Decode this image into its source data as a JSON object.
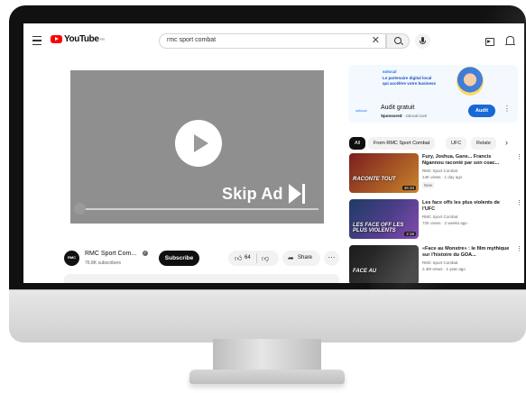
{
  "header": {
    "logo_text": "YouTube",
    "logo_region": "FR",
    "search_value": "rmc sport combat"
  },
  "player": {
    "skip_label": "Skip Ad"
  },
  "channel": {
    "avatar_text": "RMC",
    "name": "RMC Sport Com...",
    "subscribers": "76.8K subscribers",
    "subscribe_label": "Subscribe",
    "likes": "64",
    "share_label": "Share"
  },
  "ad": {
    "brand": "solocal",
    "headline_1": "Le partenaire digital local",
    "headline_2": "qui accélère votre business",
    "small_logo": "solocal",
    "title": "Audit gratuit",
    "sponsored": "Sponsored",
    "domain": "· solocal.com",
    "button": "Audit"
  },
  "chips": [
    "All",
    "From RMC Sport Combat",
    "UFC",
    "Relate"
  ],
  "recommendations": [
    {
      "title": "Fury, Joshua, Gane... Francis Ngannou raconté par son coac...",
      "channel": "RMC Sport Combat",
      "meta": "13K views · 1 day ago",
      "badge": "New",
      "overlay": "RACONTE TOUT",
      "duration": "45:33",
      "colors": [
        "#7a1f1f",
        "#c9832a"
      ]
    },
    {
      "title": "Les face offs les plus violents de l'UFC",
      "channel": "RMC Sport Combat",
      "meta": "72K views · 2 weeks ago",
      "badge": "",
      "overlay": "LES FACE OFF LES PLUS VIOLENTS",
      "duration": "2:16",
      "colors": [
        "#1c3c66",
        "#7b3fa8"
      ]
    },
    {
      "title": "«Face au Monstre» : le film mythique sur l'histoire du GOA...",
      "channel": "RMC Sport Combat",
      "meta": "2.4M views · 1 year ago",
      "badge": "",
      "overlay": "FACE AU",
      "duration": "",
      "colors": [
        "#1b1b1b",
        "#444444"
      ]
    }
  ],
  "colors": {
    "youtube_red": "#ff0000",
    "subscribe_bg": "#0f0f0f",
    "ad_button": "#065fd4",
    "player_gray": "#8f8f8f"
  },
  "icons": {
    "menu": "hamburger-icon",
    "search": "search-icon",
    "clear": "close-icon",
    "mic": "mic-icon",
    "create": "create-icon",
    "notifications": "bell-icon",
    "play": "play-icon",
    "skip": "skip-icon",
    "like": "thumb-up-icon",
    "dislike": "thumb-down-icon",
    "share": "share-icon",
    "more": "more-icon"
  }
}
